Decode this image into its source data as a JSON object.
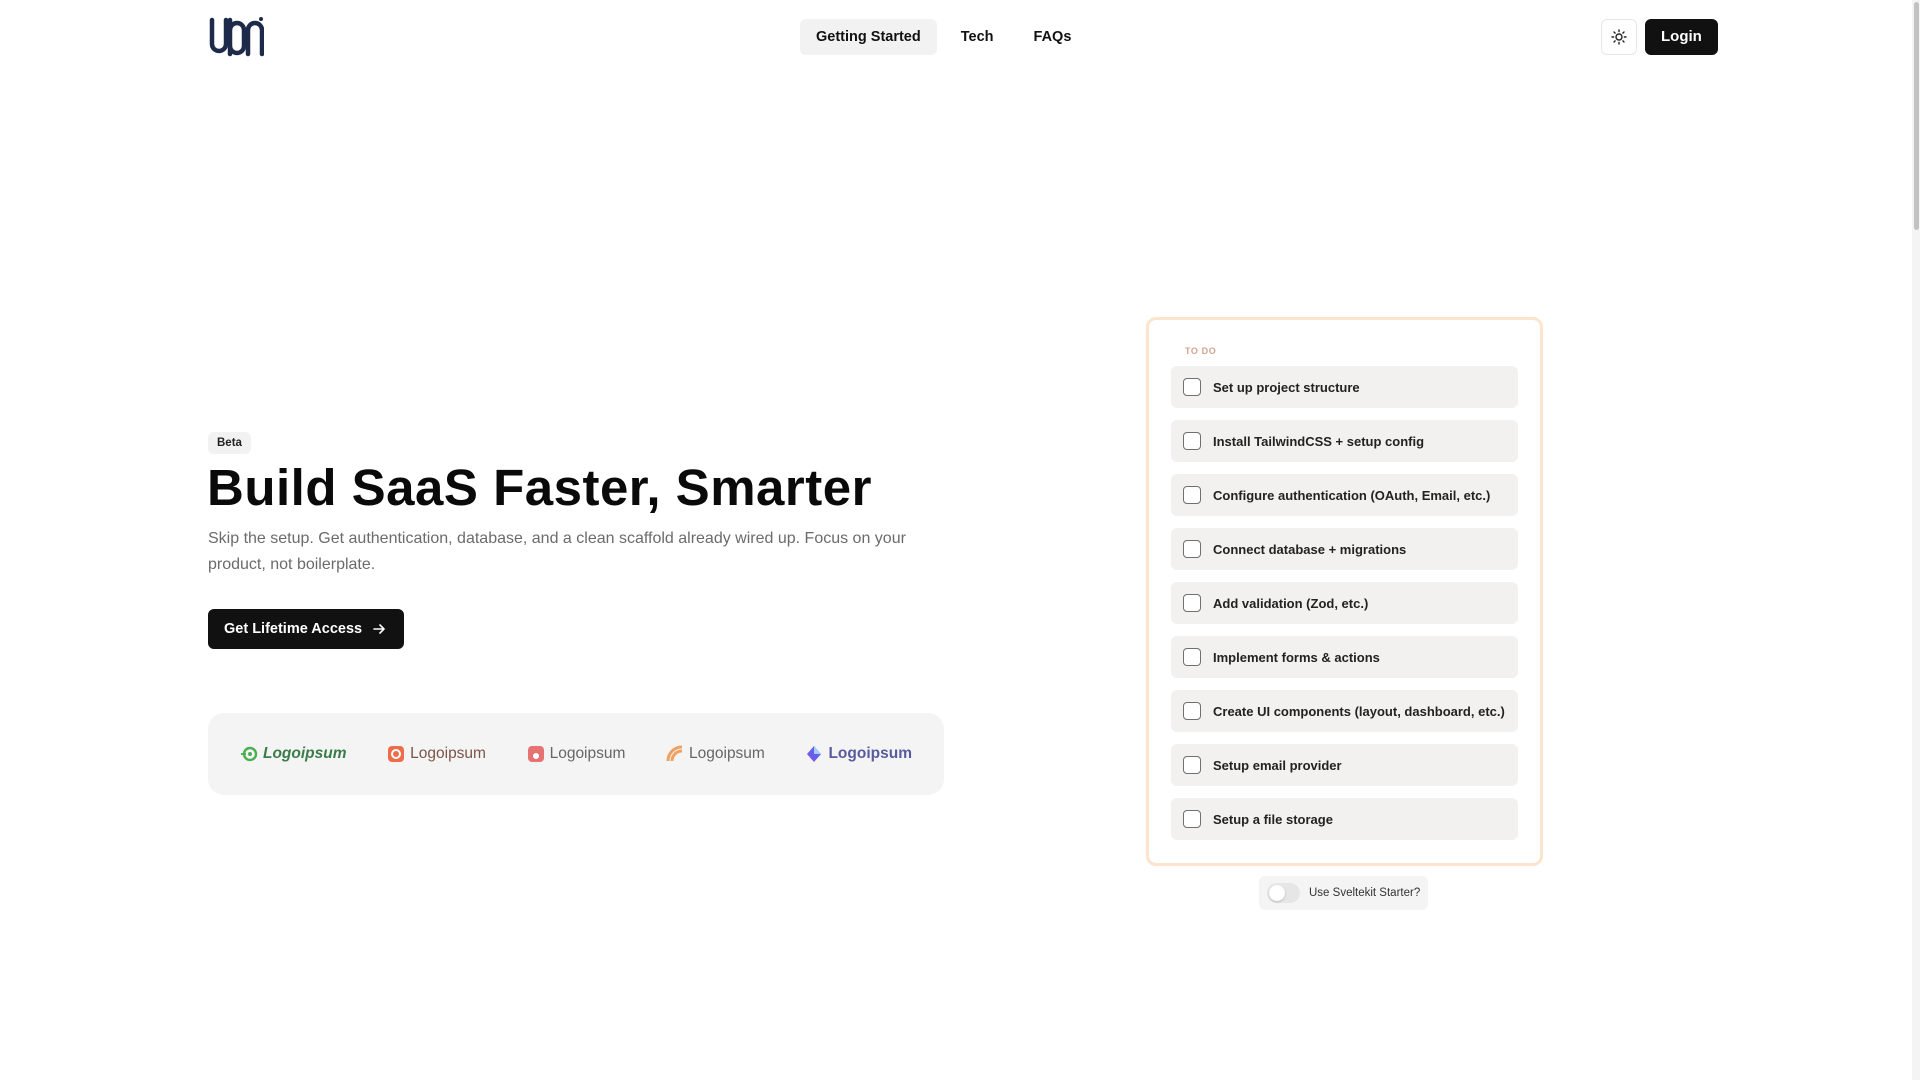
{
  "header": {
    "logo_alt": "logo",
    "nav": [
      {
        "label": "Getting Started",
        "active": true
      },
      {
        "label": "Tech",
        "active": false
      },
      {
        "label": "FAQs",
        "active": false
      }
    ],
    "theme_icon": "sun-icon",
    "login_label": "Login"
  },
  "hero": {
    "badge": "Beta",
    "headline": "Build SaaS Faster, Smarter",
    "subtext": "Skip the setup. Get authentication, database, and a clean scaffold already wired up. Focus on your product, not boilerplate.",
    "cta_label": "Get Lifetime Access",
    "cta_icon": "arrow-right-icon"
  },
  "logos": [
    {
      "name": "Logoipsum",
      "color": "#4caf50"
    },
    {
      "name": "Logoipsum",
      "color": "#ef6c4a"
    },
    {
      "name": "Logoipsum",
      "color": "#e57373"
    },
    {
      "name": "Logoipsum",
      "color": "#f0a060"
    },
    {
      "name": "Logoipsum",
      "color": "#6c5ce7"
    }
  ],
  "todo": {
    "header": "TO DO",
    "items": [
      {
        "label": "Set up project structure",
        "checked": false
      },
      {
        "label": "Install TailwindCSS + setup config",
        "checked": false
      },
      {
        "label": "Configure authentication (OAuth, Email, etc.)",
        "checked": false
      },
      {
        "label": "Connect database + migrations",
        "checked": false
      },
      {
        "label": "Add validation (Zod, etc.)",
        "checked": false
      },
      {
        "label": "Implement forms & actions",
        "checked": false
      },
      {
        "label": "Create UI components (layout, dashboard, etc.)",
        "checked": false
      },
      {
        "label": "Setup email provider",
        "checked": false
      },
      {
        "label": "Setup a file storage",
        "checked": false
      }
    ],
    "toggle_label": "Use Sveltekit Starter?",
    "toggle_on": false
  },
  "colors": {
    "primary": "#111111",
    "card_border": "#fde4cc",
    "item_bg": "#f3f1ef"
  }
}
